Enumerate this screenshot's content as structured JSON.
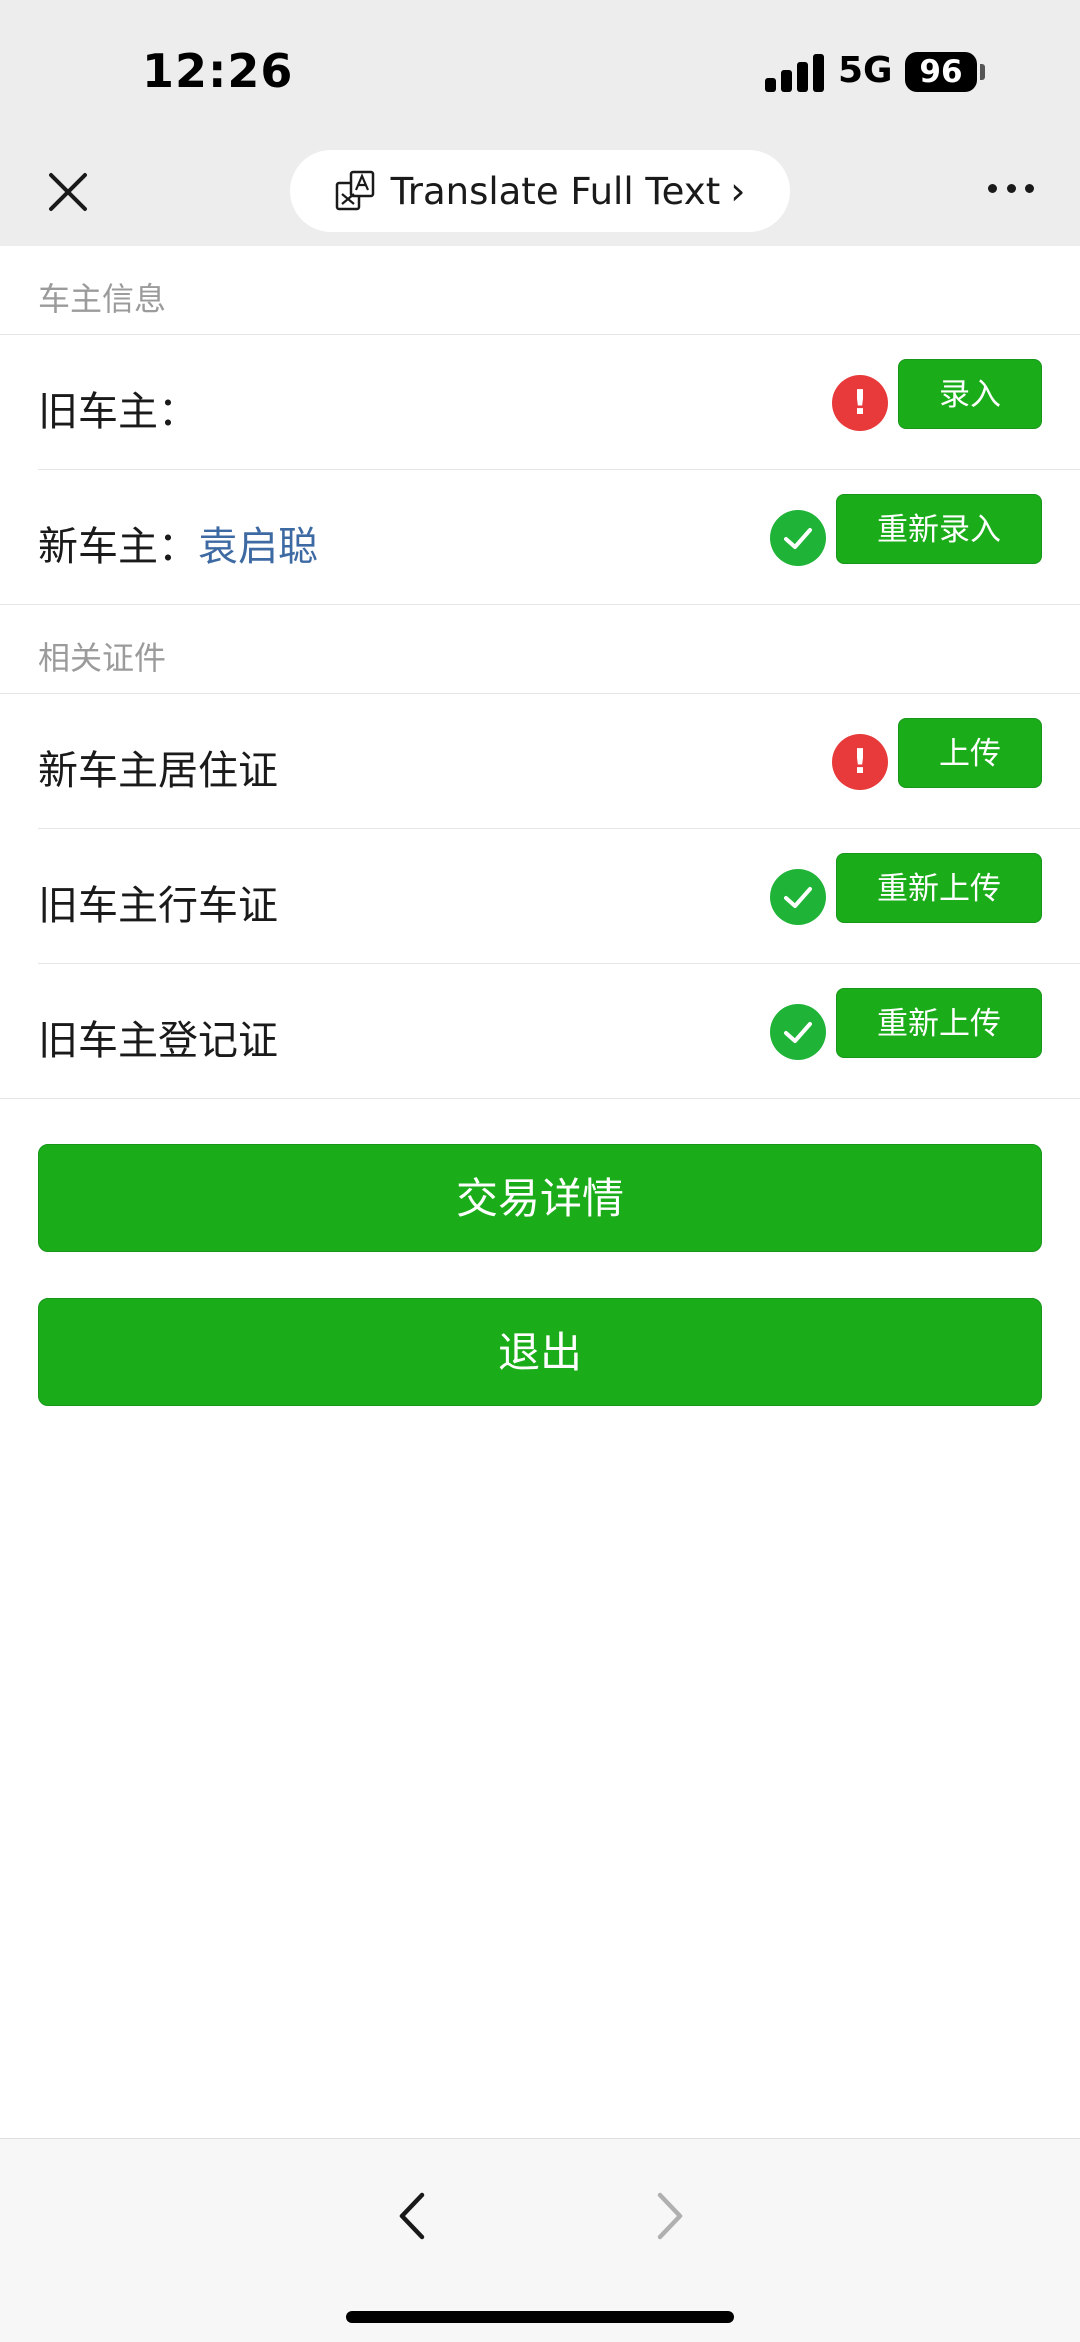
{
  "status_bar": {
    "time": "12:26",
    "network": "5G",
    "battery": "96"
  },
  "nav": {
    "translate_label": "Translate Full Text",
    "chevron": "›"
  },
  "sections": {
    "owner_info": "车主信息",
    "documents": "相关证件"
  },
  "owner_rows": [
    {
      "label": "旧车主：",
      "value": "",
      "status": "error",
      "status_glyph": "!",
      "button": "录入"
    },
    {
      "label": "新车主：",
      "value": "袁启聪",
      "status": "ok",
      "status_glyph": "",
      "button": "重新录入"
    }
  ],
  "document_rows": [
    {
      "label": "新车主居住证",
      "status": "error",
      "status_glyph": "!",
      "button": "上传"
    },
    {
      "label": "旧车主行车证",
      "status": "ok",
      "status_glyph": "",
      "button": "重新上传"
    },
    {
      "label": "旧车主登记证",
      "status": "ok",
      "status_glyph": "",
      "button": "重新上传"
    }
  ],
  "actions": {
    "details": "交易详情",
    "exit": "退出"
  },
  "colors": {
    "primary_green": "#1aad19",
    "error_red": "#e83a3a",
    "ok_green": "#1fb338",
    "link_blue": "#3e6aa3"
  },
  "icons": {
    "close": "close-icon",
    "translate": "translate-icon",
    "more": "more-icon",
    "back": "back-arrow-icon",
    "forward": "forward-arrow-icon",
    "error": "exclamation-icon",
    "ok": "checkmark-icon"
  }
}
